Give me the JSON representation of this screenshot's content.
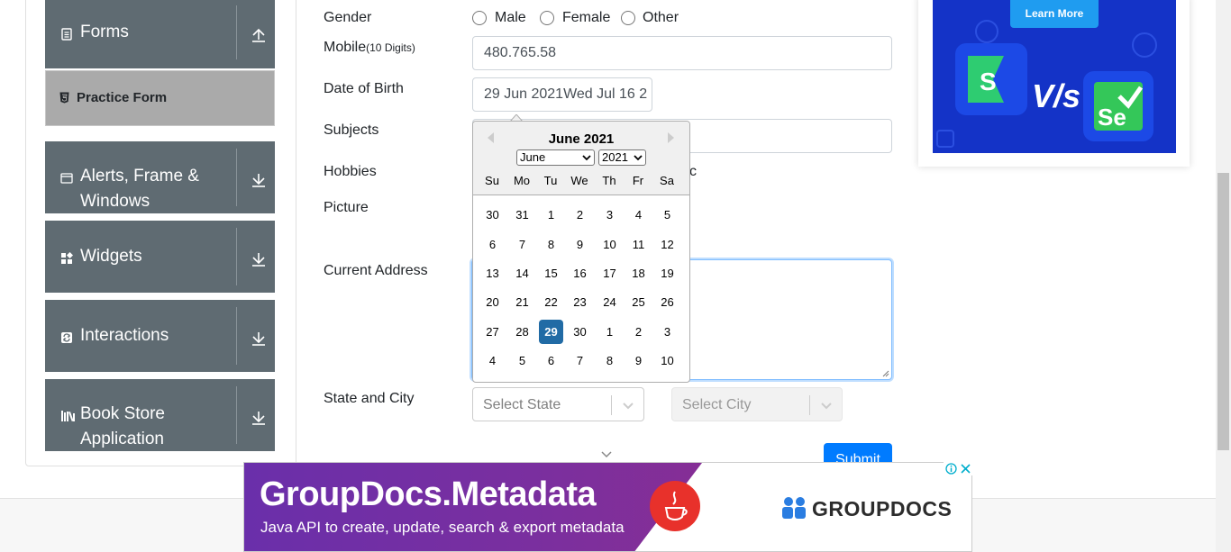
{
  "sidebar": {
    "groups": [
      {
        "label": "Forms",
        "icon": "document-icon",
        "expanded": true
      },
      {
        "label": "Alerts, Frame & Windows",
        "icon": "window-icon",
        "expanded": false
      },
      {
        "label": "Widgets",
        "icon": "widgets-icon",
        "expanded": false
      },
      {
        "label": "Interactions",
        "icon": "interactions-icon",
        "expanded": false
      },
      {
        "label": "Book Store Application",
        "icon": "books-icon",
        "expanded": false
      }
    ],
    "alerts_line1": "Alerts, Frame &",
    "alerts_line2": "Windows",
    "book_line1": "Book Store",
    "book_line2": "Application",
    "practice_form": "Practice Form"
  },
  "form": {
    "gender_label": "Gender",
    "gender_options": [
      "Male",
      "Female",
      "Other"
    ],
    "mobile_label": "Mobile",
    "mobile_hint": "(10 Digits)",
    "mobile_value": "480.765.58",
    "dob_label": "Date of Birth",
    "dob_value": "29 Jun 2021Wed Jul 16 2",
    "subjects_label": "Subjects",
    "hobbies_label": "Hobbies",
    "hobbies_partial": "c",
    "picture_label": "Picture",
    "address_label": "Current Address",
    "state_city_label": "State and City",
    "state_placeholder": "Select State",
    "city_placeholder": "Select City",
    "submit_label": "Submit"
  },
  "datepicker": {
    "header": "June 2021",
    "month_select": "June",
    "year_select": "2021",
    "day_names": [
      "Su",
      "Mo",
      "Tu",
      "We",
      "Th",
      "Fr",
      "Sa"
    ],
    "weeks": [
      [
        "30",
        "31",
        "1",
        "2",
        "3",
        "4",
        "5"
      ],
      [
        "6",
        "7",
        "8",
        "9",
        "10",
        "11",
        "12"
      ],
      [
        "13",
        "14",
        "15",
        "16",
        "17",
        "18",
        "19"
      ],
      [
        "20",
        "21",
        "22",
        "23",
        "24",
        "25",
        "26"
      ],
      [
        "27",
        "28",
        "29",
        "30",
        "1",
        "2",
        "3"
      ],
      [
        "4",
        "5",
        "6",
        "7",
        "8",
        "9",
        "10"
      ]
    ],
    "selected_day": "29",
    "selected_color": "#216ba5"
  },
  "ads": {
    "right_button": "Learn More",
    "right_vs": "V/s",
    "bottom_title": "GroupDocs.Metadata",
    "bottom_subtitle": "Java API to create, update, search & export metadata",
    "bottom_brand": "GROUPDOCS"
  },
  "colors": {
    "sidebar_bg": "#5f6b72",
    "active_item_bg": "#aaaaaa",
    "submit_bg": "#007bff"
  }
}
